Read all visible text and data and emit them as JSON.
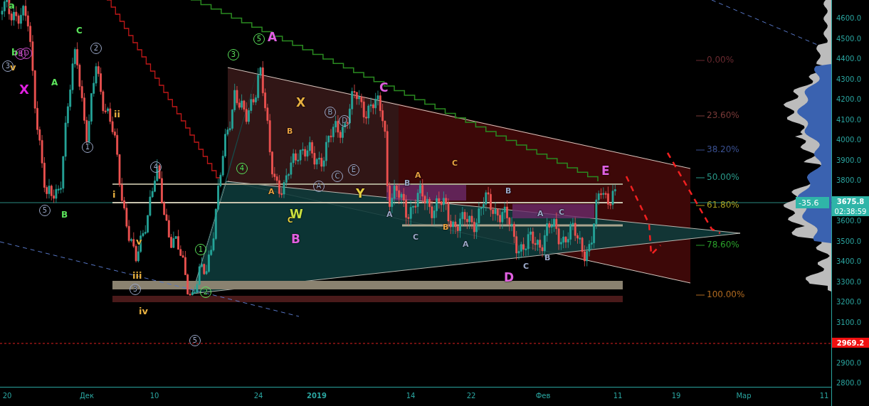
{
  "chart": {
    "wave_labels": [
      {
        "text": "a",
        "circled": false,
        "color": "#5be35b"
      },
      {
        "text": "b",
        "circled": false,
        "color": "#5be35b"
      },
      {
        "text": "v",
        "circled": false,
        "color": "#e8b040"
      },
      {
        "text": "3",
        "circled": true,
        "color": "#9aa7c7"
      },
      {
        "text": "B",
        "circled": true,
        "color": "#d050d0"
      },
      {
        "text": "D",
        "circled": true,
        "color": "#d050d0"
      },
      {
        "text": "X",
        "circled": false,
        "color": "#e020e0"
      },
      {
        "text": "A",
        "circled": false,
        "color": "#5be35b"
      },
      {
        "text": "C",
        "circled": false,
        "color": "#5be35b"
      },
      {
        "text": "2",
        "circled": true,
        "color": "#9aa7c7"
      },
      {
        "text": "1",
        "circled": true,
        "color": "#9aa7c7"
      },
      {
        "text": "ii",
        "circled": false,
        "color": "#e8b040"
      },
      {
        "text": "i",
        "circled": false,
        "color": "#e8b040"
      },
      {
        "text": "5",
        "circled": true,
        "color": "#9aa7c7"
      },
      {
        "text": "B",
        "circled": false,
        "color": "#5be35b"
      },
      {
        "text": "4",
        "circled": true,
        "color": "#9aa7c7"
      },
      {
        "text": "v",
        "circled": false,
        "color": "#e8b040"
      },
      {
        "text": "iii",
        "circled": false,
        "color": "#e8b040"
      },
      {
        "text": "3",
        "circled": true,
        "color": "#9aa7c7"
      },
      {
        "text": "iv",
        "circled": false,
        "color": "#e8b040"
      },
      {
        "text": "5",
        "circled": true,
        "color": "#9aa7c7"
      },
      {
        "text": "1",
        "circled": true,
        "color": "#5be35b"
      },
      {
        "text": "2",
        "circled": true,
        "color": "#5be35b"
      },
      {
        "text": "3",
        "circled": true,
        "color": "#5be35b"
      },
      {
        "text": "5",
        "circled": true,
        "color": "#5be35b"
      },
      {
        "text": "A",
        "circled": false,
        "color": "#e060e0"
      },
      {
        "text": "4",
        "circled": true,
        "color": "#5be35b"
      },
      {
        "text": "X",
        "circled": false,
        "color": "#e8b040"
      },
      {
        "text": "B",
        "circled": false,
        "color": "#e8a040"
      },
      {
        "text": "A",
        "circled": false,
        "color": "#e8a040"
      },
      {
        "text": "W",
        "circled": false,
        "color": "#c8e040"
      },
      {
        "text": "C",
        "circled": false,
        "color": "#e8d040"
      },
      {
        "text": "B",
        "circled": false,
        "color": "#e060e0"
      },
      {
        "text": "B",
        "circled": true,
        "color": "#9aa7c7"
      },
      {
        "text": "D",
        "circled": true,
        "color": "#9aa7c7"
      },
      {
        "text": "C",
        "circled": true,
        "color": "#9aa7c7"
      },
      {
        "text": "E",
        "circled": true,
        "color": "#9aa7c7"
      },
      {
        "text": "A",
        "circled": true,
        "color": "#9aa7c7"
      },
      {
        "text": "Y",
        "circled": false,
        "color": "#e8d040"
      },
      {
        "text": "C",
        "circled": false,
        "color": "#e060e0"
      },
      {
        "text": "A",
        "circled": false,
        "color": "#e8a040"
      },
      {
        "text": "B",
        "circled": false,
        "color": "#9aa7c7"
      },
      {
        "text": "A",
        "circled": false,
        "color": "#9aa7c7"
      },
      {
        "text": "C",
        "circled": false,
        "color": "#9aa7c7"
      },
      {
        "text": "B",
        "circled": false,
        "color": "#e8a040"
      },
      {
        "text": "C",
        "circled": false,
        "color": "#e8a040"
      },
      {
        "text": "A",
        "circled": false,
        "color": "#9aa7c7"
      },
      {
        "text": "B",
        "circled": false,
        "color": "#9aa7c7"
      },
      {
        "text": "A",
        "circled": false,
        "color": "#9aa7c7"
      },
      {
        "text": "C",
        "circled": false,
        "color": "#9aa7c7"
      },
      {
        "text": "C",
        "circled": false,
        "color": "#9aa7c7"
      },
      {
        "text": "B",
        "circled": false,
        "color": "#9aa7c7"
      },
      {
        "text": "D",
        "circled": false,
        "color": "#e060e0"
      },
      {
        "text": "E",
        "circled": false,
        "color": "#e060e0"
      }
    ],
    "fib_levels": [
      {
        "label": "0.00%",
        "color": "#6a2a30"
      },
      {
        "label": "23.60%",
        "color": "#7a3a38"
      },
      {
        "label": "38.20%",
        "color": "#3a5090"
      },
      {
        "label": "50.00%",
        "color": "#2a9a8a"
      },
      {
        "label": "61.80%",
        "color": "#a8a020"
      },
      {
        "label": "78.60%",
        "color": "#2aa02a"
      },
      {
        "label": "100.00%",
        "color": "#b06a20"
      }
    ],
    "volume_profile": {
      "label": "-35.6"
    },
    "price_axis": {
      "ticks": [
        "4600.0",
        "4500.0",
        "4400.0",
        "4300.0",
        "4200.0",
        "4100.0",
        "4000.0",
        "3900.0",
        "3800.0",
        "3600.0",
        "3500.0",
        "3400.0",
        "3300.0",
        "3200.0",
        "3100.0",
        "2900.0",
        "2800.0"
      ]
    },
    "price_tags": [
      {
        "kind": "last_price",
        "text": "3675.8"
      },
      {
        "kind": "countdown",
        "text": "02:38:59"
      },
      {
        "kind": "alert",
        "text": "2969.2"
      }
    ],
    "time_axis": {
      "ticks": [
        {
          "label": "20",
          "bold": false
        },
        {
          "label": "Дек",
          "bold": false
        },
        {
          "label": "10",
          "bold": false
        },
        {
          "label": "24",
          "bold": false
        },
        {
          "label": "2019",
          "bold": true
        },
        {
          "label": "14",
          "bold": false
        },
        {
          "label": "22",
          "bold": false
        },
        {
          "label": "Фев",
          "bold": false
        },
        {
          "label": "11",
          "bold": false
        },
        {
          "label": "19",
          "bold": false
        },
        {
          "label": "Мар",
          "bold": false
        },
        {
          "label": "11",
          "bold": false
        }
      ]
    }
  }
}
